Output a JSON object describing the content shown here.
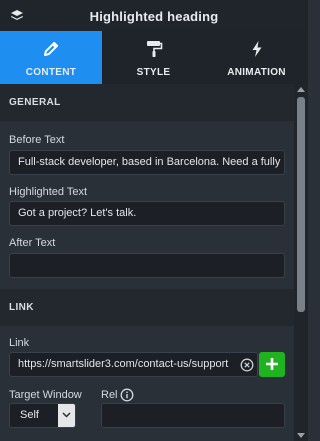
{
  "header": {
    "title": "Highlighted heading",
    "icon": "layers-icon"
  },
  "tabs": [
    {
      "label": "CONTENT",
      "icon": "pencil-icon",
      "active": true
    },
    {
      "label": "STYLE",
      "icon": "paint-roller-icon",
      "active": false
    },
    {
      "label": "ANIMATION",
      "icon": "lightning-icon",
      "active": false
    }
  ],
  "general": {
    "heading": "GENERAL",
    "before_text_label": "Before Text",
    "before_text_value": "Full-stack developer, based in Barcelona. Need a fully",
    "highlighted_text_label": "Highlighted Text",
    "highlighted_text_value": "Got a project? Let's talk.",
    "after_text_label": "After Text",
    "after_text_value": ""
  },
  "link": {
    "heading": "LINK",
    "link_label": "Link",
    "link_value": "https://smartslider3.com/contact-us/support",
    "target_window_label": "Target Window",
    "target_window_value": "Self",
    "rel_label": "Rel",
    "rel_value": ""
  },
  "colors": {
    "active_tab": "#1e8ef0",
    "add_button": "#1fb41f",
    "panel_bg": "#2a3038",
    "header_bg": "#20252c"
  }
}
